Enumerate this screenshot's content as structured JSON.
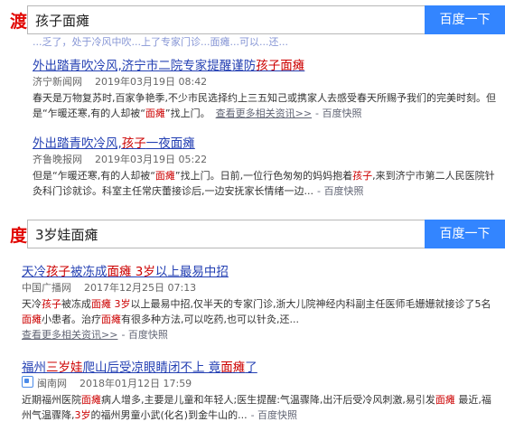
{
  "panel1": {
    "logo": "渡",
    "query": "孩子面瘫",
    "button": "百度一下",
    "cutoff_text": "...乏了，处于冷风中吹...上了专家门诊...面瘫...可以...还...",
    "results": [
      {
        "title_pre": "外出踏青吹冷风,济宁市二院专家提醒谨防",
        "title_hl": "孩子面瘫",
        "title_post": "",
        "source": "济宁新闻网",
        "time": "2019年03月19日 08:42",
        "abs_pre": "春天是万物复苏时,百家争艳季,不少市民选择约上三五知己或携家人去感受春天所赐予我们的完美时刻。但是“乍暖还寒,有的人却被“",
        "abs_hl": "面瘫",
        "abs_post": "”找上门。",
        "more": "查看更多相关资讯>>",
        "snapshot": "百度快照"
      },
      {
        "title_pre": "外出踏青吹冷风,",
        "title_hl": "孩子",
        "title_post": "一夜面瘫",
        "source": "齐鲁晚报网",
        "time": "2019年03月19日 05:22",
        "abs_pre": "但是“乍暖还寒,有的人却被“",
        "abs_hl": "面瘫",
        "abs_mid": "”找上门。日前,一位行色匆匆的妈妈抱着",
        "abs_hl2": "孩子",
        "abs_post": ",来到济宁市第二人民医院针灸科门诊就诊。科室主任常庆蕾接诊后,一边安抚家长情绪一边...",
        "snapshot": "百度快照"
      }
    ]
  },
  "panel2": {
    "logo": "度",
    "query": "3岁娃面瘫",
    "button": "百度一下",
    "results": [
      {
        "title_pre": "天冷",
        "title_hl": "孩子",
        "title_mid": "被冻成",
        "title_hl2": "面瘫 3岁",
        "title_post": "以上最易中招",
        "source": "中国广播网",
        "time": "2017年12月25日 07:13",
        "abs_pre": "天冷",
        "abs_hl": "孩子",
        "abs_mid": "被冻成",
        "abs_hl2": "面瘫 3岁",
        "abs_mid2": "以上最易中招,仅半天的专家门诊,浙大儿院神经内科副主任医师毛姗姗就接诊了5名",
        "abs_hl3": "面瘫",
        "abs_mid3": "小患者。治疗",
        "abs_hl4": "面瘫",
        "abs_post": "有很多种方法,可以吃药,也可以针灸,还...",
        "more": "查看更多相关资讯>>",
        "snapshot": "百度快照"
      },
      {
        "title_pre": "福州",
        "title_hl": "三岁娃",
        "title_mid": "爬山后受凉眼睛闭不上 竟",
        "title_hl2": "面瘫",
        "title_post": "了",
        "source": "闽南网",
        "time": "2018年01月12日 17:59",
        "abs_pre": "近期福州医院",
        "abs_hl": "面瘫",
        "abs_mid": "病人增多,主要是儿童和年轻人;医生提醒:气温骤降,出汗后受冷风刺激,易引发",
        "abs_hl2": "面瘫",
        "abs_mid2": " 最近,福州气温骤降,",
        "abs_hl3": "3岁",
        "abs_post": "的福州男童小武(化名)到金牛山的...",
        "snapshot": "百度快照"
      }
    ]
  }
}
